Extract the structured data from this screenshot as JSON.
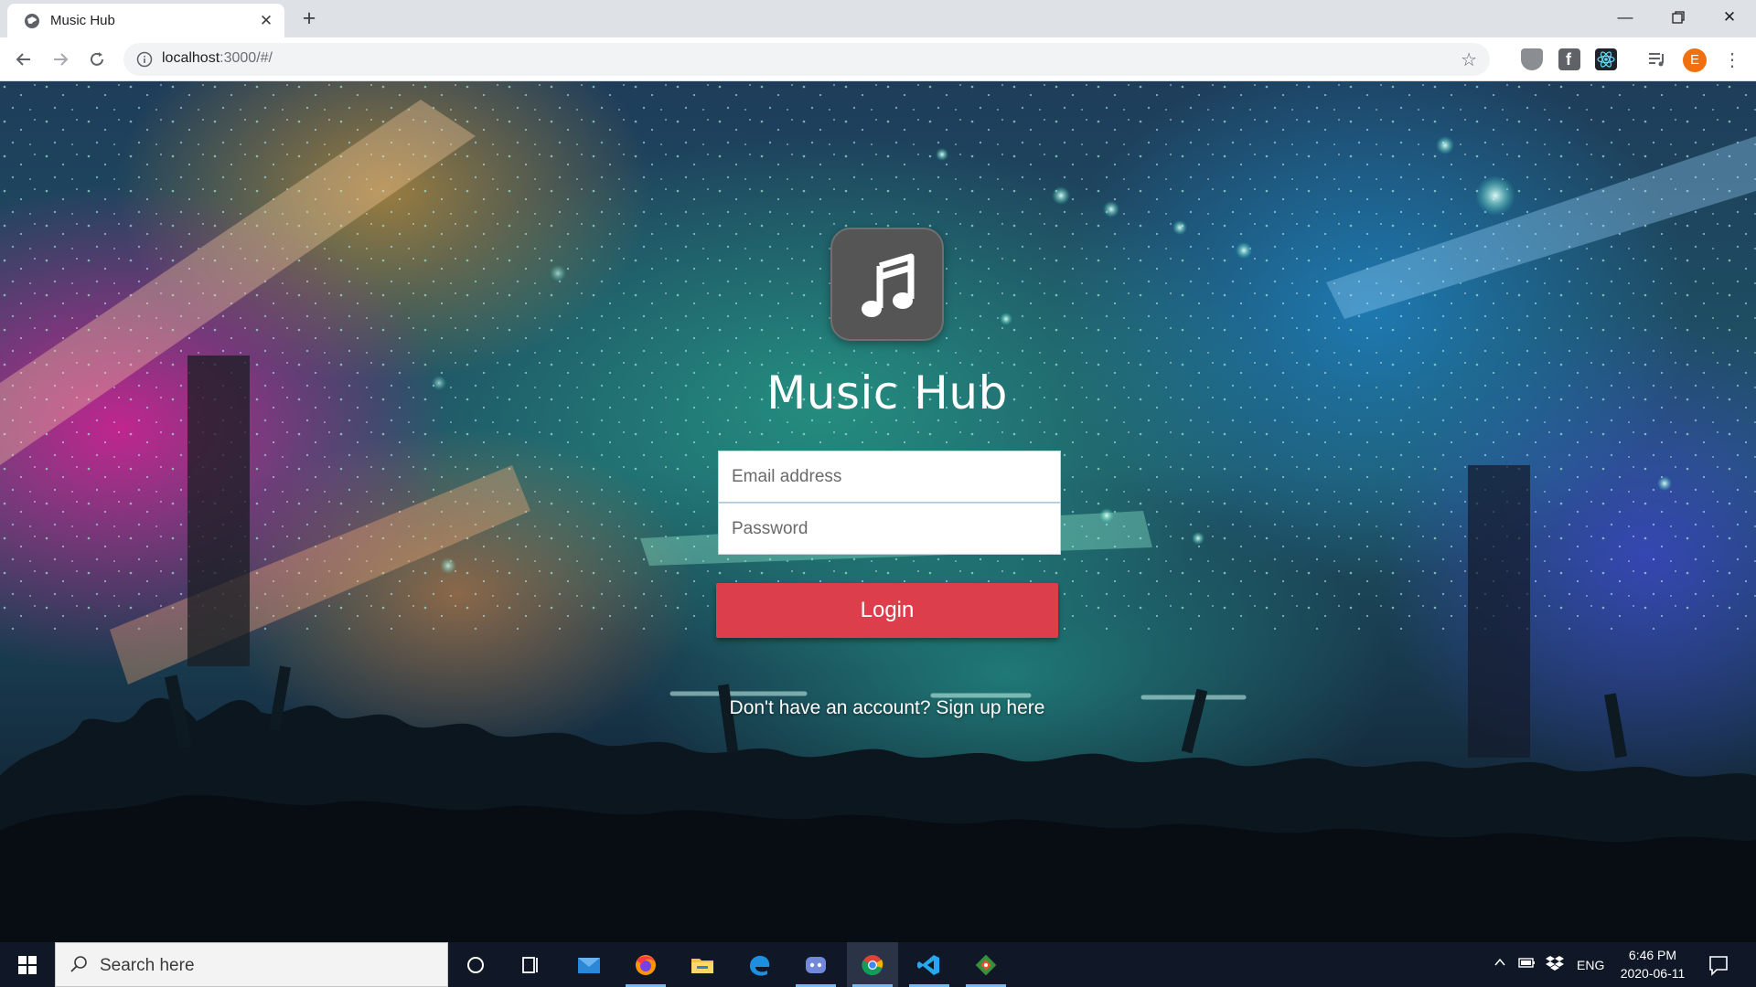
{
  "browser": {
    "tab_title": "Music Hub",
    "url_host": "localhost",
    "url_rest": ":3000/#/",
    "profile_initial": "E"
  },
  "app": {
    "title": "Music Hub",
    "email_placeholder": "Email address",
    "password_placeholder": "Password",
    "login_label": "Login",
    "signup_text": "Don't have an account? Sign up here",
    "accent_color": "#dc3e4c"
  },
  "taskbar": {
    "search_placeholder": "Search here",
    "language": "ENG",
    "time": "6:46 PM",
    "date": "2020-06-11",
    "pinned_apps": [
      "cortana-icon",
      "task-view-icon",
      "mail-icon",
      "firefox-icon",
      "file-explorer-icon",
      "edge-icon",
      "discord-icon",
      "chrome-icon",
      "vscode-icon",
      "git-icon"
    ]
  }
}
